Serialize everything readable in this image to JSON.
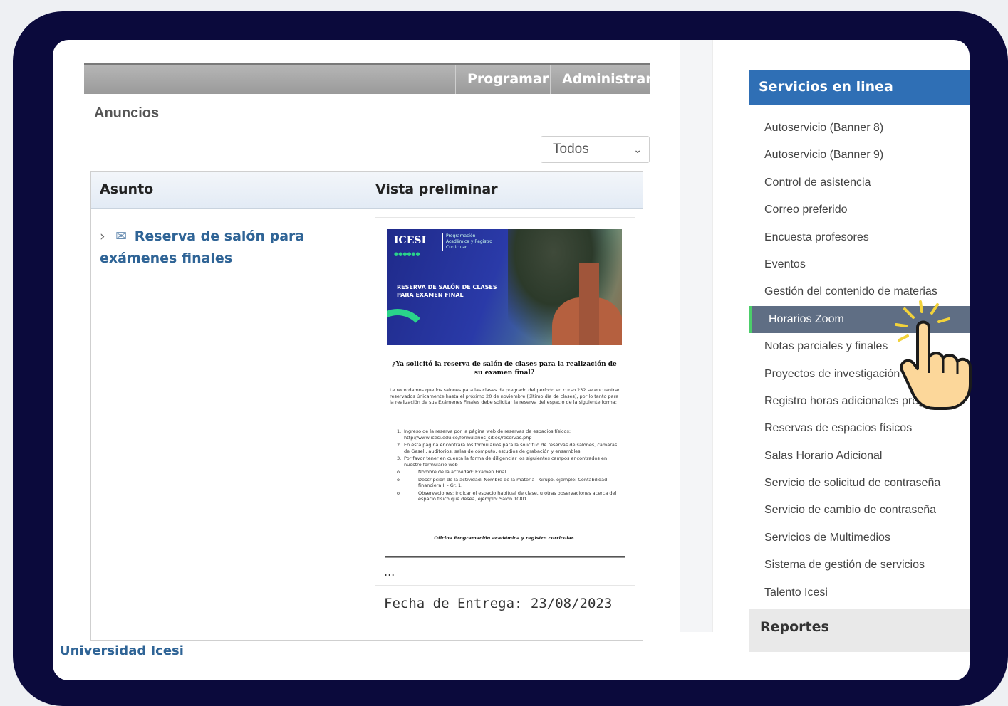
{
  "toolbar": {
    "programar": "Programar",
    "administrar": "Administrar"
  },
  "anuncios": {
    "title": "Anuncios"
  },
  "filter": {
    "selected": "Todos"
  },
  "table": {
    "col_asunto": "Asunto",
    "col_vista": "Vista preliminar",
    "subject": "Reserva de salón para exámenes finales"
  },
  "preview": {
    "logo": "ICESI",
    "logo_sub": "Programación Académica y Registro Curricular",
    "banner_title": "RESERVA DE SALÓN DE CLASES PARA EXAMEN FINAL",
    "question": "¿Ya solicitó la reserva de salón de clases para la realización de su examen final?",
    "body": "Le recordamos que los salones para las clases de pregrado del período en curso 232 se encuentran reservados únicamente hasta el próximo 20 de noviembre (último día de clases), por lo tanto para la realización de sus Exámenes Finales debe solicitar la reserva del espacio de la siguiente forma:",
    "steps": [
      "Ingreso de la reserva por la página web de reservas de espacios físicos: http://www.icesi.edu.co/formularios_sitios/reservas.php",
      "En esta página encontrará los formularios para la solicitud de reservas de salones, cámaras de Gesell, auditorios, salas de cómputo, estudios de grabación y ensambles.",
      "Por favor tener en cuenta la forma de diligenciar los siguientes campos encontrados en nuestro formulario web"
    ],
    "substeps": [
      "Nombre de la actividad: Examen Final.",
      "Descripción de la actividad: Nombre de la materia - Grupo, ejemplo: Contabilidad financiera II - Gr. 1.",
      "Observaciones: Indicar el espacio habitual de clase, u otras observaciones acerca del espacio físico que desea, ejemplo: Salón 108D"
    ],
    "signature": "Oficina Programación académica y registro curricular.",
    "ellipsis": "...",
    "fecha": "Fecha de Entrega: 23/08/2023"
  },
  "footer": {
    "text": "Universidad Icesi"
  },
  "sidebar": {
    "title": "Servicios en linea",
    "items": [
      "Autoservicio (Banner 8)",
      "Autoservicio (Banner 9)",
      "Control de asistencia",
      "Correo preferido",
      "Encuesta profesores",
      "Eventos",
      "Gestión del contenido de materias",
      "Horarios Zoom",
      "Notas parciales y finales",
      "Proyectos de investigación",
      "Registro horas adicionales pregrado",
      "Reservas de espacios físicos",
      "Salas Horario Adicional",
      "Servicio de solicitud de contraseña",
      "Servicio de cambio de contraseña",
      "Servicios de Multimedios",
      "Sistema de gestión de servicios",
      "Talento Icesi"
    ],
    "active_item": "Horarios Zoom",
    "reportes": "Reportes"
  },
  "colors": {
    "frame": "#0b0a3c",
    "sidebar_header": "#2f6fb5",
    "active_bg": "#5f6e84",
    "active_accent": "#4cce6a",
    "link": "#2f6496"
  },
  "icons": [
    "chevron-right-icon",
    "envelope-icon",
    "chevron-down-icon",
    "pointing-hand-icon"
  ]
}
